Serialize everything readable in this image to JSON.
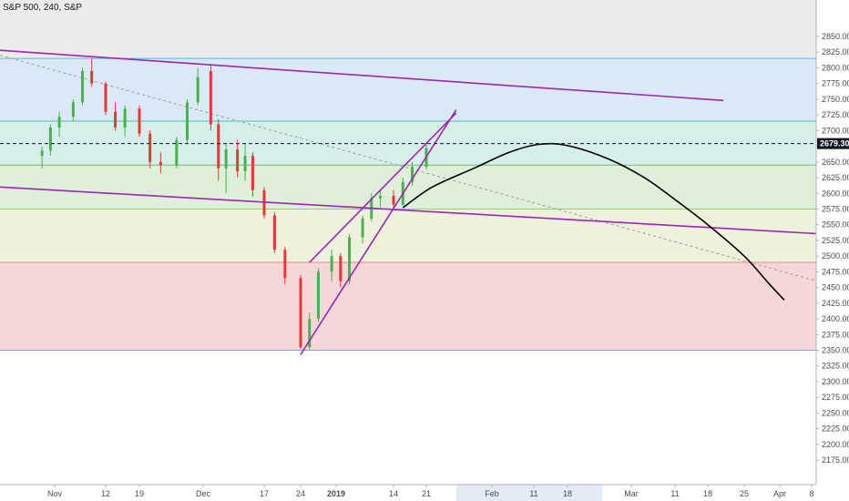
{
  "header": {
    "symbol_label": "S&P 500, 240, S&P"
  },
  "price_marker": {
    "label": "2679.30",
    "value": 2679.3
  },
  "chart_data": {
    "type": "candlestick",
    "title": "S&P 500, 240, S&P",
    "y_axis": {
      "range": [
        2160,
        2860
      ],
      "ticks": [
        2175,
        2200,
        2225,
        2250,
        2275,
        2300,
        2325,
        2350,
        2375,
        2400,
        2425,
        2450,
        2475,
        2500,
        2525,
        2550,
        2575,
        2600,
        2625,
        2650,
        2675,
        2700,
        2725,
        2750,
        2775,
        2800,
        2825,
        2850
      ],
      "tick_labels": [
        "2175.00",
        "2200.00",
        "2225.00",
        "2250.00",
        "2275.00",
        "2300.00",
        "2325.00",
        "2350.00",
        "2375.00",
        "2400.00",
        "2425.00",
        "2450.00",
        "2475.00",
        "2500.00",
        "2525.00",
        "2550.00",
        "2575.00",
        "2600.00",
        "2625.00",
        "2650.00",
        "2675.00",
        "2700.00",
        "2725.00",
        "2750.00",
        "2775.00",
        "2800.00",
        "2825.00",
        "2850.00"
      ]
    },
    "x_axis": {
      "labels": [
        "Nov",
        "12",
        "19",
        "Dec",
        "17",
        "24",
        "2019",
        "14",
        "21",
        "Feb",
        "11",
        "18",
        "Mar",
        "11",
        "18",
        "25",
        "Apr",
        "8"
      ],
      "dates": [
        "2018-11-01",
        "2018-11-12",
        "2018-11-19",
        "2018-12-01",
        "2018-12-17",
        "2018-12-24",
        "2019-01-01",
        "2019-01-14",
        "2019-01-21",
        "2019-02-01",
        "2019-02-11",
        "2019-02-18",
        "2019-03-01",
        "2019-03-11",
        "2019-03-18",
        "2019-03-25",
        "2019-04-01",
        "2019-04-08"
      ],
      "highlighted": [
        "Feb",
        "11",
        "18"
      ]
    },
    "fib_zones": [
      {
        "from": 2815,
        "to": 2715,
        "color": "#dbe9f6"
      },
      {
        "from": 2715,
        "to": 2645,
        "color": "#d7efec"
      },
      {
        "from": 2645,
        "to": 2575,
        "color": "#dff0da"
      },
      {
        "from": 2575,
        "to": 2490,
        "color": "#eef2dc"
      },
      {
        "from": 2490,
        "to": 2350,
        "color": "#f6d7d7"
      }
    ],
    "fib_levels": [
      2815,
      2715,
      2645,
      2575,
      2490,
      2350
    ],
    "candles": [
      {
        "t": "2018-10-29",
        "o": 2660,
        "h": 2675,
        "l": 2640,
        "c": 2668
      },
      {
        "t": "2018-10-31",
        "o": 2668,
        "h": 2710,
        "l": 2660,
        "c": 2705
      },
      {
        "t": "2018-11-02",
        "o": 2705,
        "h": 2730,
        "l": 2690,
        "c": 2722
      },
      {
        "t": "2018-11-05",
        "o": 2722,
        "h": 2750,
        "l": 2715,
        "c": 2745
      },
      {
        "t": "2018-11-07",
        "o": 2745,
        "h": 2800,
        "l": 2740,
        "c": 2795
      },
      {
        "t": "2018-11-09",
        "o": 2795,
        "h": 2815,
        "l": 2770,
        "c": 2775
      },
      {
        "t": "2018-11-12",
        "o": 2775,
        "h": 2778,
        "l": 2725,
        "c": 2730
      },
      {
        "t": "2018-11-14",
        "o": 2730,
        "h": 2745,
        "l": 2700,
        "c": 2705
      },
      {
        "t": "2018-11-16",
        "o": 2705,
        "h": 2740,
        "l": 2690,
        "c": 2735
      },
      {
        "t": "2018-11-19",
        "o": 2735,
        "h": 2740,
        "l": 2690,
        "c": 2695
      },
      {
        "t": "2018-11-21",
        "o": 2695,
        "h": 2700,
        "l": 2640,
        "c": 2650
      },
      {
        "t": "2018-11-23",
        "o": 2650,
        "h": 2665,
        "l": 2632,
        "c": 2645
      },
      {
        "t": "2018-11-26",
        "o": 2645,
        "h": 2690,
        "l": 2640,
        "c": 2685
      },
      {
        "t": "2018-11-28",
        "o": 2685,
        "h": 2750,
        "l": 2680,
        "c": 2745
      },
      {
        "t": "2018-11-30",
        "o": 2745,
        "h": 2800,
        "l": 2740,
        "c": 2785
      },
      {
        "t": "2018-12-03",
        "o": 2795,
        "h": 2805,
        "l": 2700,
        "c": 2710
      },
      {
        "t": "2018-12-05",
        "o": 2710,
        "h": 2718,
        "l": 2620,
        "c": 2640
      },
      {
        "t": "2018-12-07",
        "o": 2640,
        "h": 2680,
        "l": 2600,
        "c": 2670
      },
      {
        "t": "2018-12-10",
        "o": 2670,
        "h": 2685,
        "l": 2625,
        "c": 2635
      },
      {
        "t": "2018-12-12",
        "o": 2635,
        "h": 2680,
        "l": 2620,
        "c": 2660
      },
      {
        "t": "2018-12-14",
        "o": 2660,
        "h": 2665,
        "l": 2595,
        "c": 2605
      },
      {
        "t": "2018-12-17",
        "o": 2605,
        "h": 2610,
        "l": 2560,
        "c": 2565
      },
      {
        "t": "2018-12-19",
        "o": 2565,
        "h": 2570,
        "l": 2505,
        "c": 2510
      },
      {
        "t": "2018-12-21",
        "o": 2510,
        "h": 2515,
        "l": 2455,
        "c": 2465
      },
      {
        "t": "2018-12-24",
        "o": 2465,
        "h": 2470,
        "l": 2352,
        "c": 2355
      },
      {
        "t": "2018-12-26",
        "o": 2355,
        "h": 2410,
        "l": 2350,
        "c": 2400
      },
      {
        "t": "2018-12-28",
        "o": 2400,
        "h": 2480,
        "l": 2395,
        "c": 2475
      },
      {
        "t": "2018-12-31",
        "o": 2475,
        "h": 2510,
        "l": 2460,
        "c": 2500
      },
      {
        "t": "2019-01-02",
        "o": 2500,
        "h": 2505,
        "l": 2450,
        "c": 2460
      },
      {
        "t": "2019-01-04",
        "o": 2460,
        "h": 2535,
        "l": 2455,
        "c": 2530
      },
      {
        "t": "2019-01-07",
        "o": 2530,
        "h": 2565,
        "l": 2520,
        "c": 2560
      },
      {
        "t": "2019-01-09",
        "o": 2560,
        "h": 2600,
        "l": 2555,
        "c": 2592
      },
      {
        "t": "2019-01-11",
        "o": 2592,
        "h": 2605,
        "l": 2578,
        "c": 2596
      },
      {
        "t": "2019-01-14",
        "o": 2596,
        "h": 2605,
        "l": 2575,
        "c": 2582
      },
      {
        "t": "2019-01-16",
        "o": 2582,
        "h": 2625,
        "l": 2580,
        "c": 2618
      },
      {
        "t": "2019-01-18",
        "o": 2618,
        "h": 2650,
        "l": 2612,
        "c": 2642
      },
      {
        "t": "2019-01-21",
        "o": 2642,
        "h": 2680,
        "l": 2638,
        "c": 2672
      }
    ],
    "trendlines": [
      {
        "from": [
          "2018-10-19",
          2828
        ],
        "to": [
          "2019-03-21",
          2748
        ],
        "color": "#9c27b0"
      },
      {
        "from": [
          "2018-10-19",
          2610
        ],
        "to": [
          "2019-04-15",
          2533
        ],
        "color": "#9c27b0"
      },
      {
        "from": [
          "2018-12-24",
          2343
        ],
        "to": [
          "2019-01-26",
          2733
        ],
        "color": "#9c27b0"
      },
      {
        "from": [
          "2018-12-26",
          2490
        ],
        "to": [
          "2019-01-26",
          2728
        ],
        "color": "#9c27b0"
      }
    ],
    "dotted_trendline": {
      "from": [
        "2018-10-19",
        2820
      ],
      "to": [
        "2019-04-15",
        2447
      ],
      "color": "#9e9e9e"
    },
    "projection": {
      "color": "#000000",
      "points": [
        [
          "2019-01-16",
          2577
        ],
        [
          "2019-01-22",
          2610
        ],
        [
          "2019-01-29",
          2640
        ],
        [
          "2019-02-05",
          2665
        ],
        [
          "2019-02-12",
          2678
        ],
        [
          "2019-02-18",
          2676
        ],
        [
          "2019-02-25",
          2655
        ],
        [
          "2019-03-04",
          2625
        ],
        [
          "2019-03-11",
          2590
        ],
        [
          "2019-03-18",
          2550
        ],
        [
          "2019-03-25",
          2500
        ],
        [
          "2019-03-30",
          2455
        ],
        [
          "2019-04-02",
          2430
        ]
      ]
    }
  }
}
